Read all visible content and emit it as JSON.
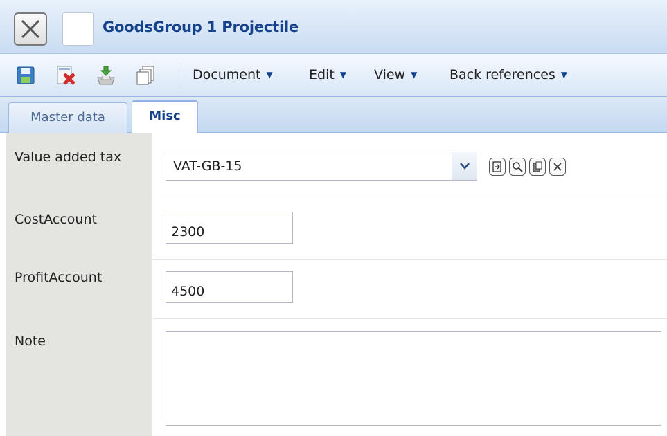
{
  "window": {
    "title": "GoodsGroup 1 Projectile"
  },
  "toolbar": {
    "icons": [
      "save-icon",
      "delete-icon",
      "import-icon",
      "copy-icon"
    ],
    "menus": [
      {
        "label": "Document"
      },
      {
        "label": "Edit"
      },
      {
        "label": "View"
      },
      {
        "label": "Back references"
      }
    ]
  },
  "tabs": [
    {
      "label": "Master data",
      "active": false
    },
    {
      "label": "Misc",
      "active": true
    }
  ],
  "form": {
    "vat": {
      "label": "Value added tax",
      "value": "VAT-GB-15"
    },
    "cost_account": {
      "label": "CostAccount",
      "value": "2300"
    },
    "profit_account": {
      "label": "ProfitAccount",
      "value": "4500"
    },
    "note": {
      "label": "Note",
      "value": ""
    }
  },
  "colors": {
    "title_text": "#15428b",
    "label_column": "#e4e4e1",
    "toolbar_border": "#99bbe8"
  }
}
